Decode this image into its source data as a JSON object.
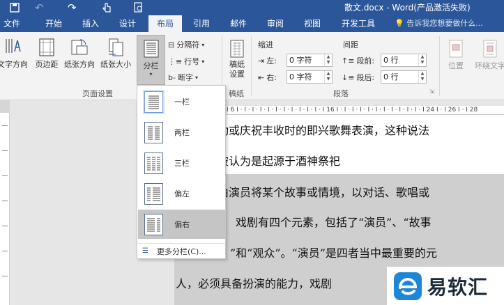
{
  "window": {
    "title": "散文.docx - Word(产品激活失败)"
  },
  "tabs": [
    {
      "label": "文件"
    },
    {
      "label": "开始"
    },
    {
      "label": "插入"
    },
    {
      "label": "设计"
    },
    {
      "label": "布局"
    },
    {
      "label": "引用"
    },
    {
      "label": "邮件"
    },
    {
      "label": "审阅"
    },
    {
      "label": "视图"
    },
    {
      "label": "开发工具"
    }
  ],
  "tell_me": {
    "placeholder": "告诉我您想要做什么..."
  },
  "ribbon": {
    "page_setup": {
      "label": "页面设置",
      "text_direction": "文字方向",
      "margins": "页边距",
      "orientation": "纸张方向",
      "size": "纸张大小",
      "columns": "分栏",
      "breaks": "分隔符",
      "line_numbers": "行号",
      "hyphenation": "断字"
    },
    "draft": {
      "label": "稿纸",
      "button": "稿纸设置"
    },
    "paragraph": {
      "label": "段落",
      "indent": "缩进",
      "spacing": "间距",
      "left_label": "左:",
      "left_value": "0 字符",
      "right_label": "右:",
      "right_value": "0 字符",
      "before_label": "段前:",
      "before_value": "0 行",
      "after_label": "段后:",
      "after_value": "0 行"
    },
    "arrange": {
      "position": "位置",
      "wrap_text": "环绕文字"
    }
  },
  "columns_menu": {
    "items": [
      {
        "label": "一栏",
        "cols": 1
      },
      {
        "label": "两栏",
        "cols": 2
      },
      {
        "label": "三栏",
        "cols": 3
      },
      {
        "label": "偏左",
        "cols": "left"
      },
      {
        "label": "偏右",
        "cols": "right"
      }
    ],
    "more": "更多分栏(C)..."
  },
  "document": {
    "lines": [
      "动或庆祝丰收时的即兴歌舞表演，这种说法",
      "被认为是起源于酒神祭祀",
      "由演员将某个故事或情境，以对话、歌唱或",
      "戏剧有四个元素，包括了“演员”、“故事",
      "”和“观众”。“演员”是四者当中最重要的元",
      "人，必须具备扮演的能力，戏剧"
    ]
  },
  "ruler": {
    "marks": "I 6 I · I · I · I · I · I · I · I · I · I · I · I 16 I · I · I · I · I · I · I · I · I · I · I · I 24 I · I 26 I · I 28"
  },
  "watermark": {
    "text": "易软汇"
  }
}
